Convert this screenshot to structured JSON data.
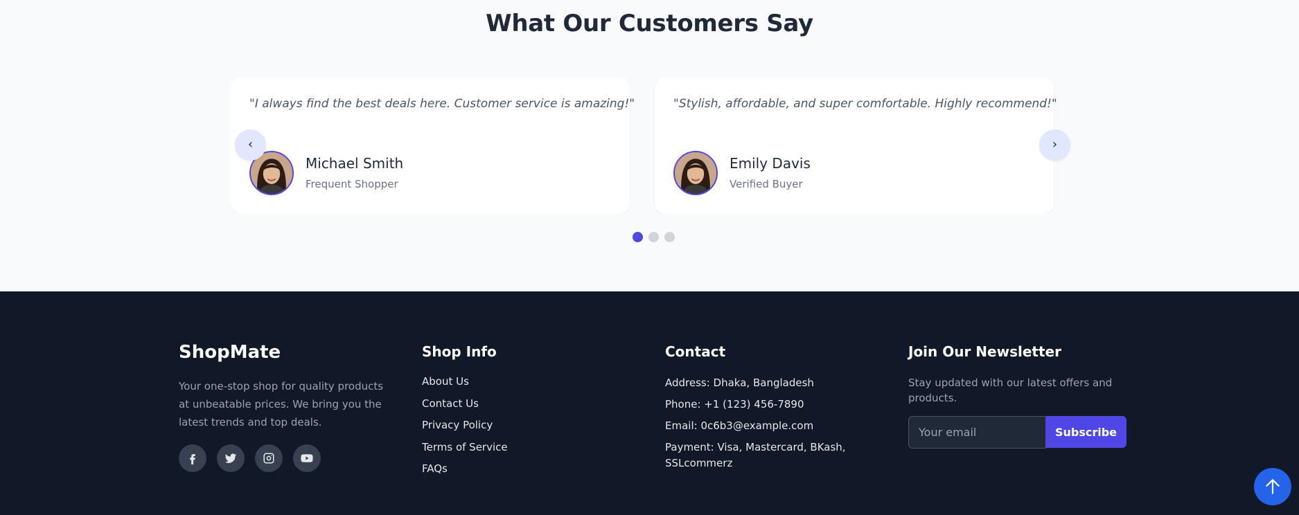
{
  "testimonials": {
    "title": "What Our Customers Say",
    "items": [
      {
        "quote": "\"I always find the best deals here. Customer service is amazing!\"",
        "name": "Michael Smith",
        "role": "Frequent Shopper"
      },
      {
        "quote": "\"Stylish, affordable, and super comfortable. Highly recommend!\"",
        "name": "Emily Davis",
        "role": "Verified Buyer"
      }
    ],
    "prev_label": "‹",
    "next_label": "›",
    "dots_count": 3,
    "active_dot": 1
  },
  "footer": {
    "brand": "ShopMate",
    "description": "Your one-stop shop for quality products at unbeatable prices. We bring you the latest trends and top deals.",
    "socials": [
      "facebook-icon",
      "twitter-icon",
      "instagram-icon",
      "youtube-icon"
    ],
    "shop_info": {
      "title": "Shop Info",
      "links": [
        "About Us",
        "Contact Us",
        "Privacy Policy",
        "Terms of Service",
        "FAQs"
      ]
    },
    "contact": {
      "title": "Contact",
      "lines": [
        "Address: Dhaka, Bangladesh",
        "Phone: +1 (123) 456-7890",
        "Email: 0c6b3@example.com",
        "Payment: Visa, Mastercard, BKash, SSLcommerz"
      ]
    },
    "newsletter": {
      "title": "Join Our Newsletter",
      "description": "Stay updated with our latest offers and products.",
      "placeholder": "Your email",
      "value": "",
      "button": "Subscribe"
    }
  },
  "colors": {
    "accent": "#4f46e5",
    "footer_bg": "#111827",
    "page_bg": "#f8fafc",
    "back_to_top": "#2563eb"
  }
}
